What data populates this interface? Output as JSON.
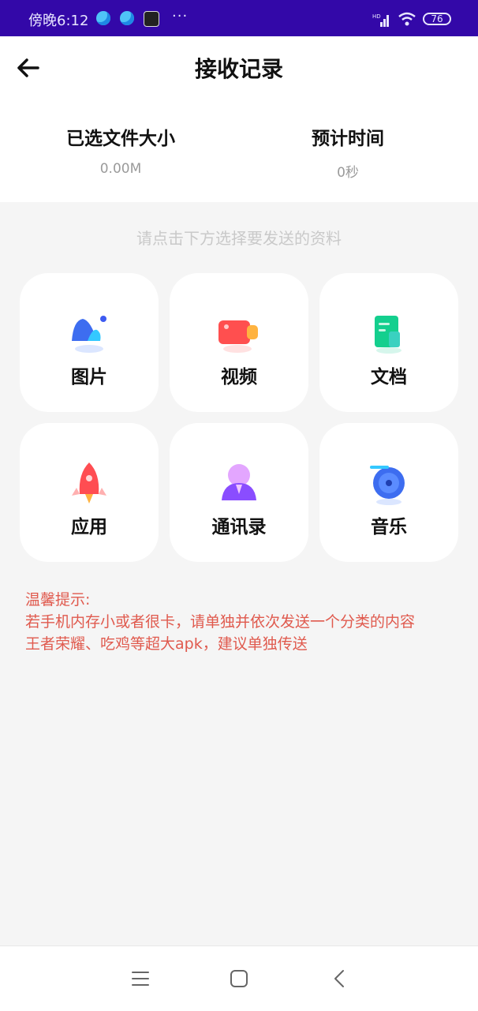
{
  "status_bar": {
    "time": "傍晚6:12",
    "more": "···",
    "battery": "76",
    "network": "HD"
  },
  "header": {
    "title": "接收记录"
  },
  "stats": [
    {
      "label": "已选文件大小",
      "value": "0.00M"
    },
    {
      "label": "预计时间",
      "value": "0秒"
    }
  ],
  "hint": "请点击下方选择要发送的资料",
  "categories": [
    {
      "label": "图片",
      "icon": "image-icon"
    },
    {
      "label": "视频",
      "icon": "video-icon"
    },
    {
      "label": "文档",
      "icon": "document-icon"
    },
    {
      "label": "应用",
      "icon": "rocket-icon"
    },
    {
      "label": "通讯录",
      "icon": "contacts-icon"
    },
    {
      "label": "音乐",
      "icon": "music-icon"
    }
  ],
  "tips": {
    "title": "温馨提示:",
    "line1": "若手机内存小或者很卡，请单独并依次发送一个分类的内容",
    "line2": "王者荣耀、吃鸡等超大apk，建议单独传送"
  },
  "colors": {
    "status_bar": "#3308a8",
    "tip_text": "#e05a4e",
    "hint_text": "#c9c9c9"
  }
}
